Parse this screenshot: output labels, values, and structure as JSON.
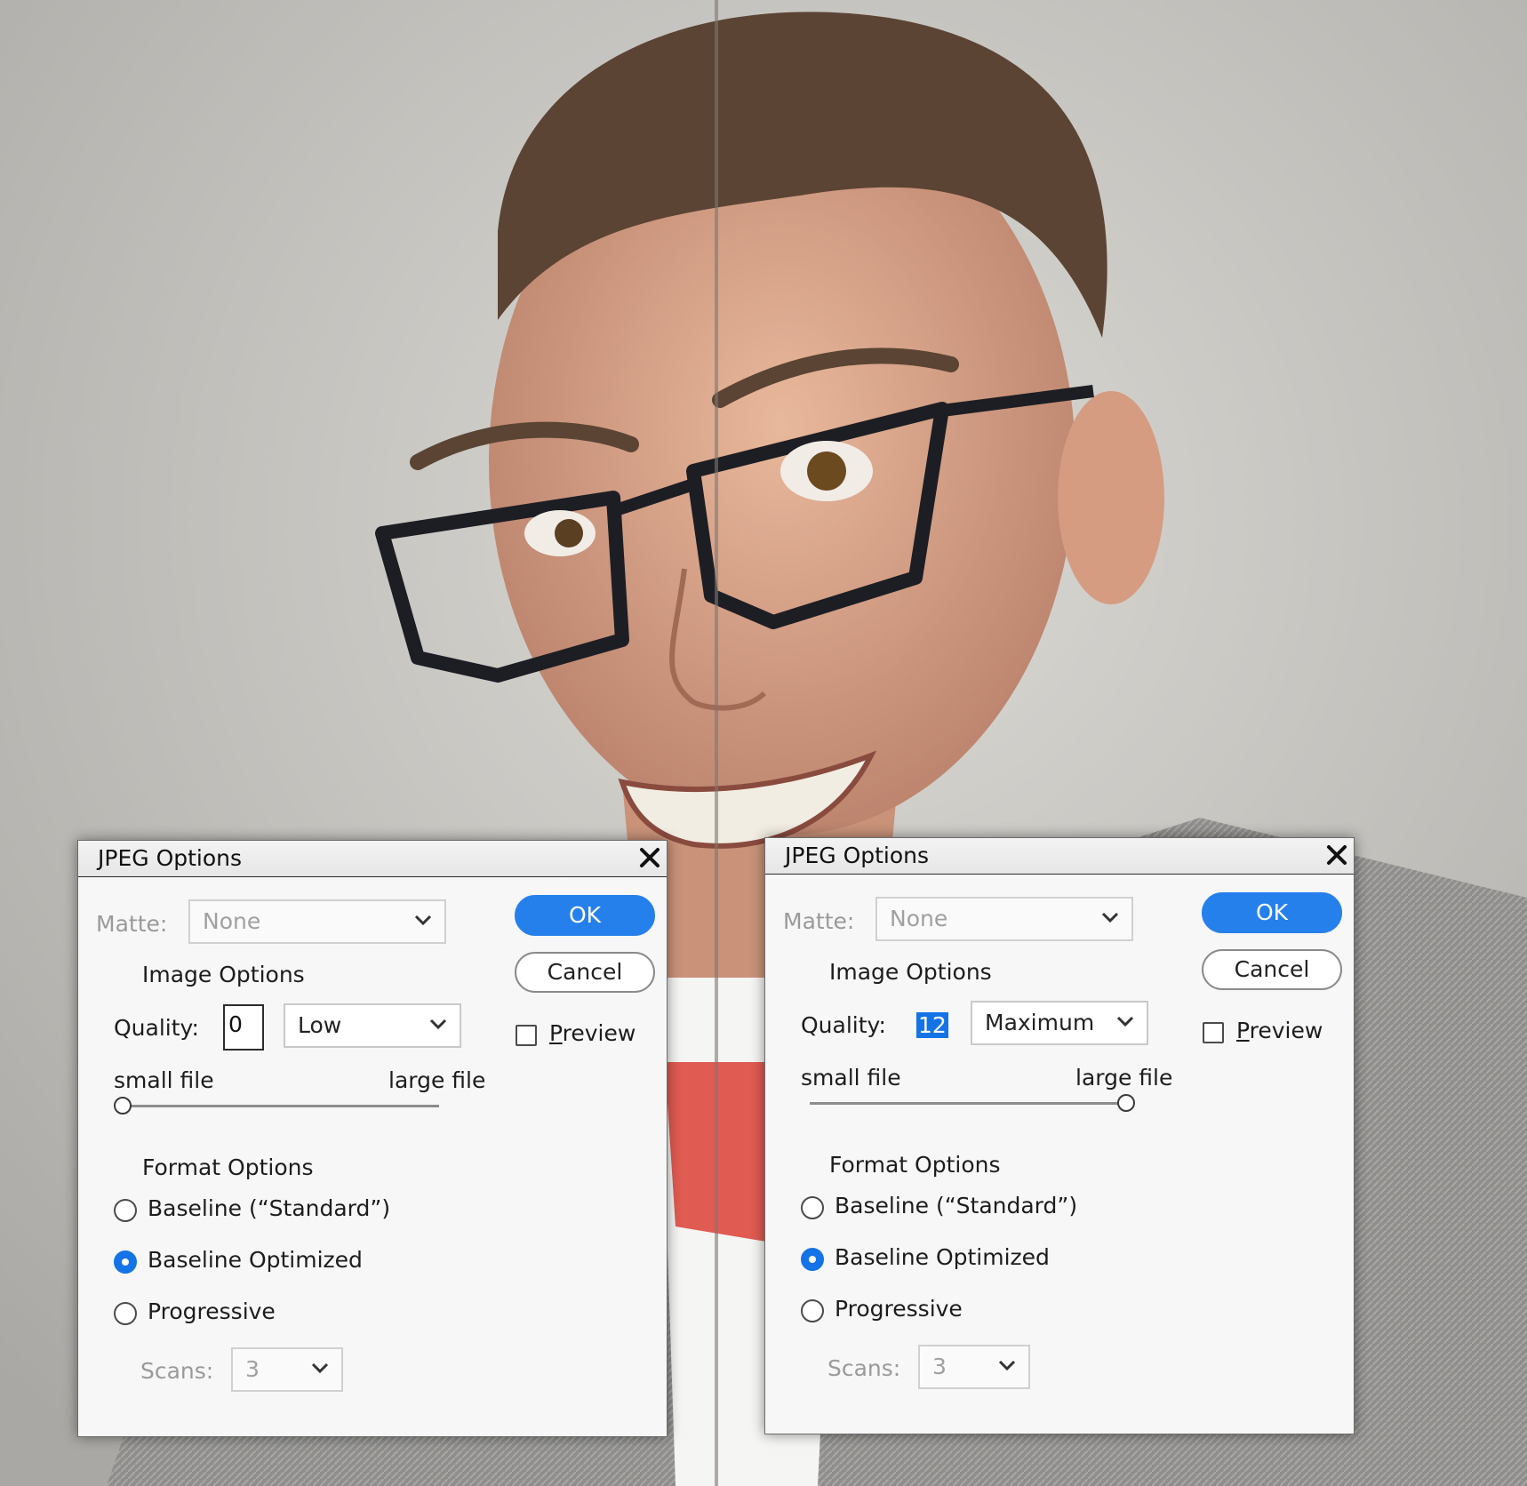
{
  "dialogs": [
    {
      "title": "JPEG Options",
      "matte_label": "Matte:",
      "matte_value": "None",
      "image_options_label": "Image Options",
      "quality_label": "Quality:",
      "quality_value": "0",
      "quality_preset": "Low",
      "slider_min_label": "small file",
      "slider_max_label": "large file",
      "quality_slider_fraction": 0,
      "format_options_label": "Format Options",
      "format_baseline": "Baseline (“Standard”)",
      "format_optimized": "Baseline Optimized",
      "format_progressive": "Progressive",
      "selected_format": "Baseline Optimized",
      "scans_label": "Scans:",
      "scans_value": "3",
      "ok_label": "OK",
      "cancel_label": "Cancel",
      "preview_label": "Preview",
      "preview_checked": false
    },
    {
      "title": "JPEG Options",
      "matte_label": "Matte:",
      "matte_value": "None",
      "image_options_label": "Image Options",
      "quality_label": "Quality:",
      "quality_value": "12",
      "quality_preset": "Maximum",
      "slider_min_label": "small file",
      "slider_max_label": "large file",
      "quality_slider_fraction": 1,
      "format_options_label": "Format Options",
      "format_baseline": "Baseline (“Standard”)",
      "format_optimized": "Baseline Optimized",
      "format_progressive": "Progressive",
      "selected_format": "Baseline Optimized",
      "scans_label": "Scans:",
      "scans_value": "3",
      "ok_label": "OK",
      "cancel_label": "Cancel",
      "preview_label": "Preview",
      "preview_checked": false
    }
  ],
  "colors": {
    "accent": "#2680eb",
    "selection": "#1473e6"
  }
}
